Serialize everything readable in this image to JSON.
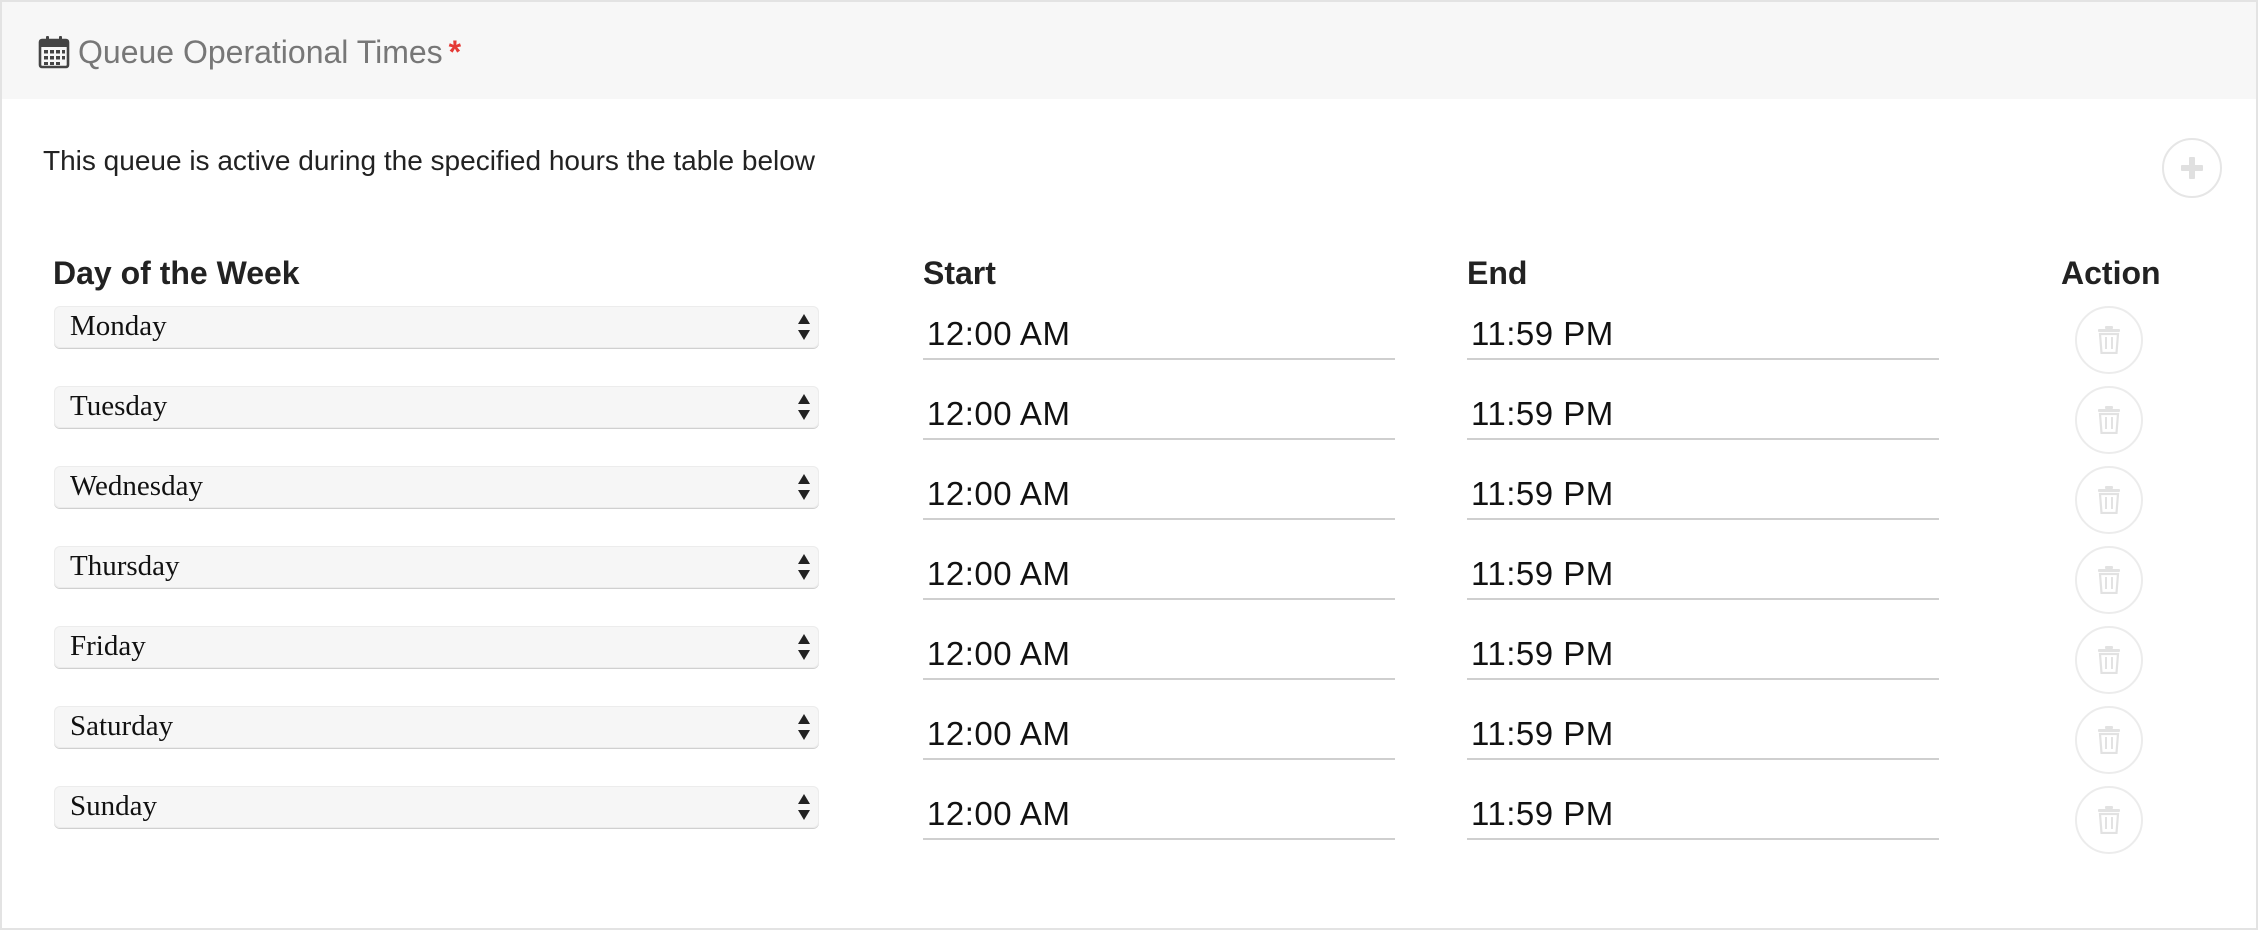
{
  "header": {
    "title": "Queue Operational Times",
    "required_mark": "*",
    "icon": "calendar-icon"
  },
  "description": "This queue is active during the specified hours the table below",
  "add_button": {
    "icon": "plus-icon"
  },
  "table": {
    "columns": [
      "Day of the Week",
      "Start",
      "End",
      "Action"
    ],
    "rows": [
      {
        "day": "Monday",
        "start": "12:00 AM",
        "end": "11:59 PM"
      },
      {
        "day": "Tuesday",
        "start": "12:00 AM",
        "end": "11:59 PM"
      },
      {
        "day": "Wednesday",
        "start": "12:00 AM",
        "end": "11:59 PM"
      },
      {
        "day": "Thursday",
        "start": "12:00 AM",
        "end": "11:59 PM"
      },
      {
        "day": "Friday",
        "start": "12:00 AM",
        "end": "11:59 PM"
      },
      {
        "day": "Saturday",
        "start": "12:00 AM",
        "end": "11:59 PM"
      },
      {
        "day": "Sunday",
        "start": "12:00 AM",
        "end": "11:59 PM"
      }
    ],
    "action_icon": "trash-icon"
  },
  "colors": {
    "required": "#e53935",
    "header_background": "#f7f7f7",
    "muted_icon": "#e0e0e0"
  }
}
